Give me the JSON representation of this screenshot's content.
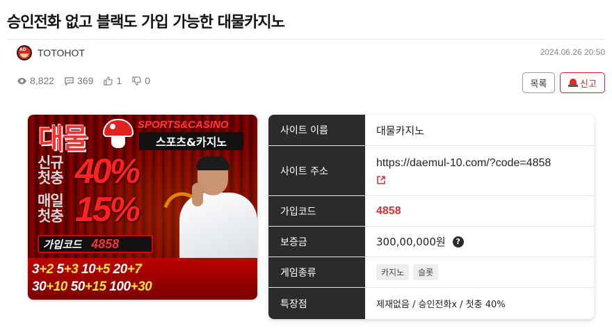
{
  "post": {
    "title": "승인전화 없고 블랙도 가입 가능한 대물카지노",
    "author": "TOTOHOT",
    "avatar_text": "AD",
    "date": "2024.06.26 20:50",
    "views": "8,822",
    "comments": "369",
    "likes": "1",
    "dislikes": "0"
  },
  "buttons": {
    "list": "목록",
    "report": "신고"
  },
  "banner": {
    "brand": "대물",
    "sports_en": "SPORTS&CASINO",
    "sports_kr": "스포츠&카지노",
    "line1_label_a": "신규",
    "line1_label_b": "첫충",
    "line1_pct": "40%",
    "line2_label_a": "매일",
    "line2_label_b": "첫충",
    "line2_pct": "15%",
    "code_label": "가입코드",
    "code_value": "4858",
    "bonus_line1": [
      "3",
      "+2",
      " 5",
      "+3",
      " 10",
      "+5",
      " 20",
      "+7"
    ],
    "bonus_line2": [
      "30",
      "+10",
      " 50",
      "+15",
      " 100",
      "+30"
    ]
  },
  "info": {
    "site_name_label": "사이트 이름",
    "site_name": "대물카지노",
    "site_url_label": "사이트 주소",
    "site_url": "https://daemul-10.com/?code=4858",
    "code_label": "가입코드",
    "code": "4858",
    "deposit_label": "보증금",
    "deposit": "300,00,000원",
    "games_label": "게임종류",
    "games": [
      "카지노",
      "슬롯"
    ],
    "features_label": "특장점",
    "features": "제재없음 / 승인전화x / 첫충 40%"
  },
  "colors": {
    "accent": "#c4262a",
    "label_bg": "#2b2b2b",
    "code_red": "#d03333"
  }
}
